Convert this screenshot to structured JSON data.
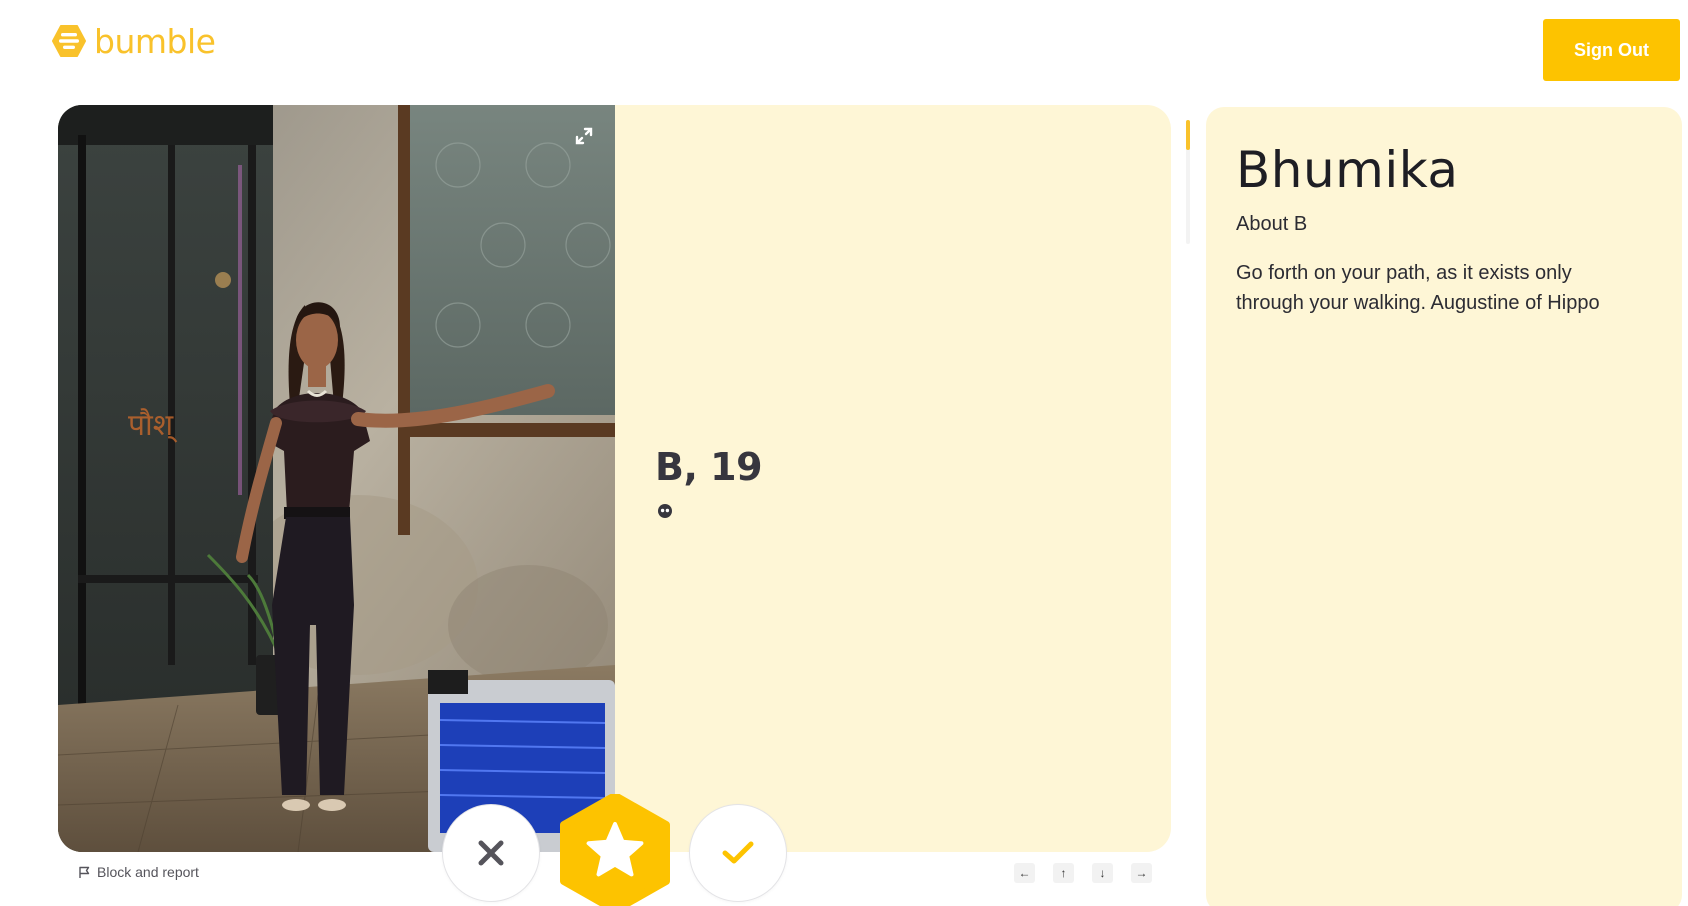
{
  "brand": {
    "name": "bumble",
    "color": "#f9c22b"
  },
  "header": {
    "signout_label": "Sign Out"
  },
  "profile": {
    "name_age": "B, 19",
    "photo": "profile-photo",
    "icons": {
      "expand": "expand-icon",
      "status": "status-icon"
    }
  },
  "actions": {
    "block_report_label": "Block and report",
    "pass": "close-icon",
    "superswipe": "star-icon",
    "like": "check-icon"
  },
  "keyboard_hints": [
    "←",
    "↑",
    "↓",
    "→"
  ],
  "about": {
    "name": "Bhumika",
    "heading": "About B",
    "bio": "Go forth on your path, as it exists only through your walking. Augustine of Hippo"
  },
  "colors": {
    "accent": "#fdc300",
    "card_bg": "#fef6d6",
    "text_dark": "#37363e"
  }
}
